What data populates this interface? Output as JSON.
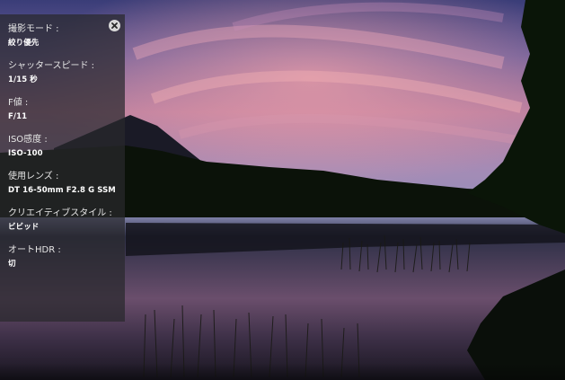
{
  "photo": {
    "subject": "lake-sunset-landscape",
    "sky_top_color": "#3c3f7a",
    "sky_glow_color": "#d08aa0",
    "water_color": "#2a2d44",
    "treeline_color": "#0b1209"
  },
  "info_panel": {
    "close_icon": "close-icon",
    "items": [
      {
        "label": "撮影モード :",
        "value": "絞り優先"
      },
      {
        "label": "シャッタースピード :",
        "value": "1/15 秒"
      },
      {
        "label": "F値 :",
        "value": "F/11"
      },
      {
        "label": "ISO感度 :",
        "value": "ISO-100"
      },
      {
        "label": "使用レンズ :",
        "value": "DT 16-50mm F2.8 G SSM"
      },
      {
        "label": "クリエイティブスタイル :",
        "value": "ビビッド"
      },
      {
        "label": "オートHDR :",
        "value": "切"
      }
    ]
  }
}
